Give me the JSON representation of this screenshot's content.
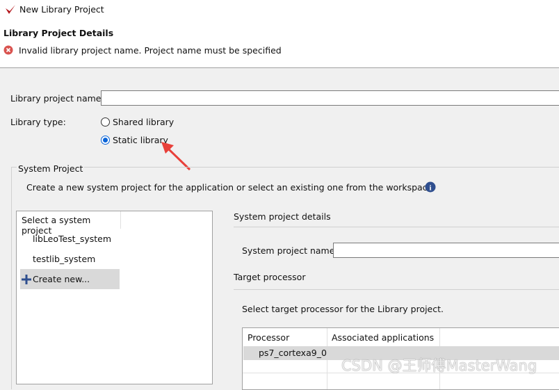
{
  "window": {
    "title": "New Library Project",
    "icon": "xilinx-logo-icon"
  },
  "header": {
    "title": "Library Project Details",
    "error": "Invalid library project name. Project name must be specified",
    "error_icon": "error-icon"
  },
  "form": {
    "name_label": "Library project name:",
    "name_value": "",
    "type_label": "Library type:",
    "types": [
      {
        "label": "Shared library",
        "selected": false
      },
      {
        "label": "Static library",
        "selected": true
      }
    ]
  },
  "system_project": {
    "group_label": "System Project",
    "description": "Create a new system project for the application or select an existing one from the workspace",
    "list_header": "Select a system project",
    "items": [
      "libLeoTest_system",
      "testlib_system",
      "Create new..."
    ],
    "selected_item": "Create new...",
    "details_title": "System project details",
    "name_label": "System project name:",
    "name_value": "",
    "target_title": "Target processor",
    "target_desc": "Select target processor for the Library project.",
    "columns": [
      "Processor",
      "Associated applications"
    ],
    "rows": [
      [
        "ps7_cortexa9_0",
        ""
      ]
    ]
  },
  "watermark": "CSDN @王师傅MasterWang",
  "colors": {
    "arrow": "#e8403a",
    "info": "#2f4f8f",
    "selection": "#d9d9d9"
  }
}
